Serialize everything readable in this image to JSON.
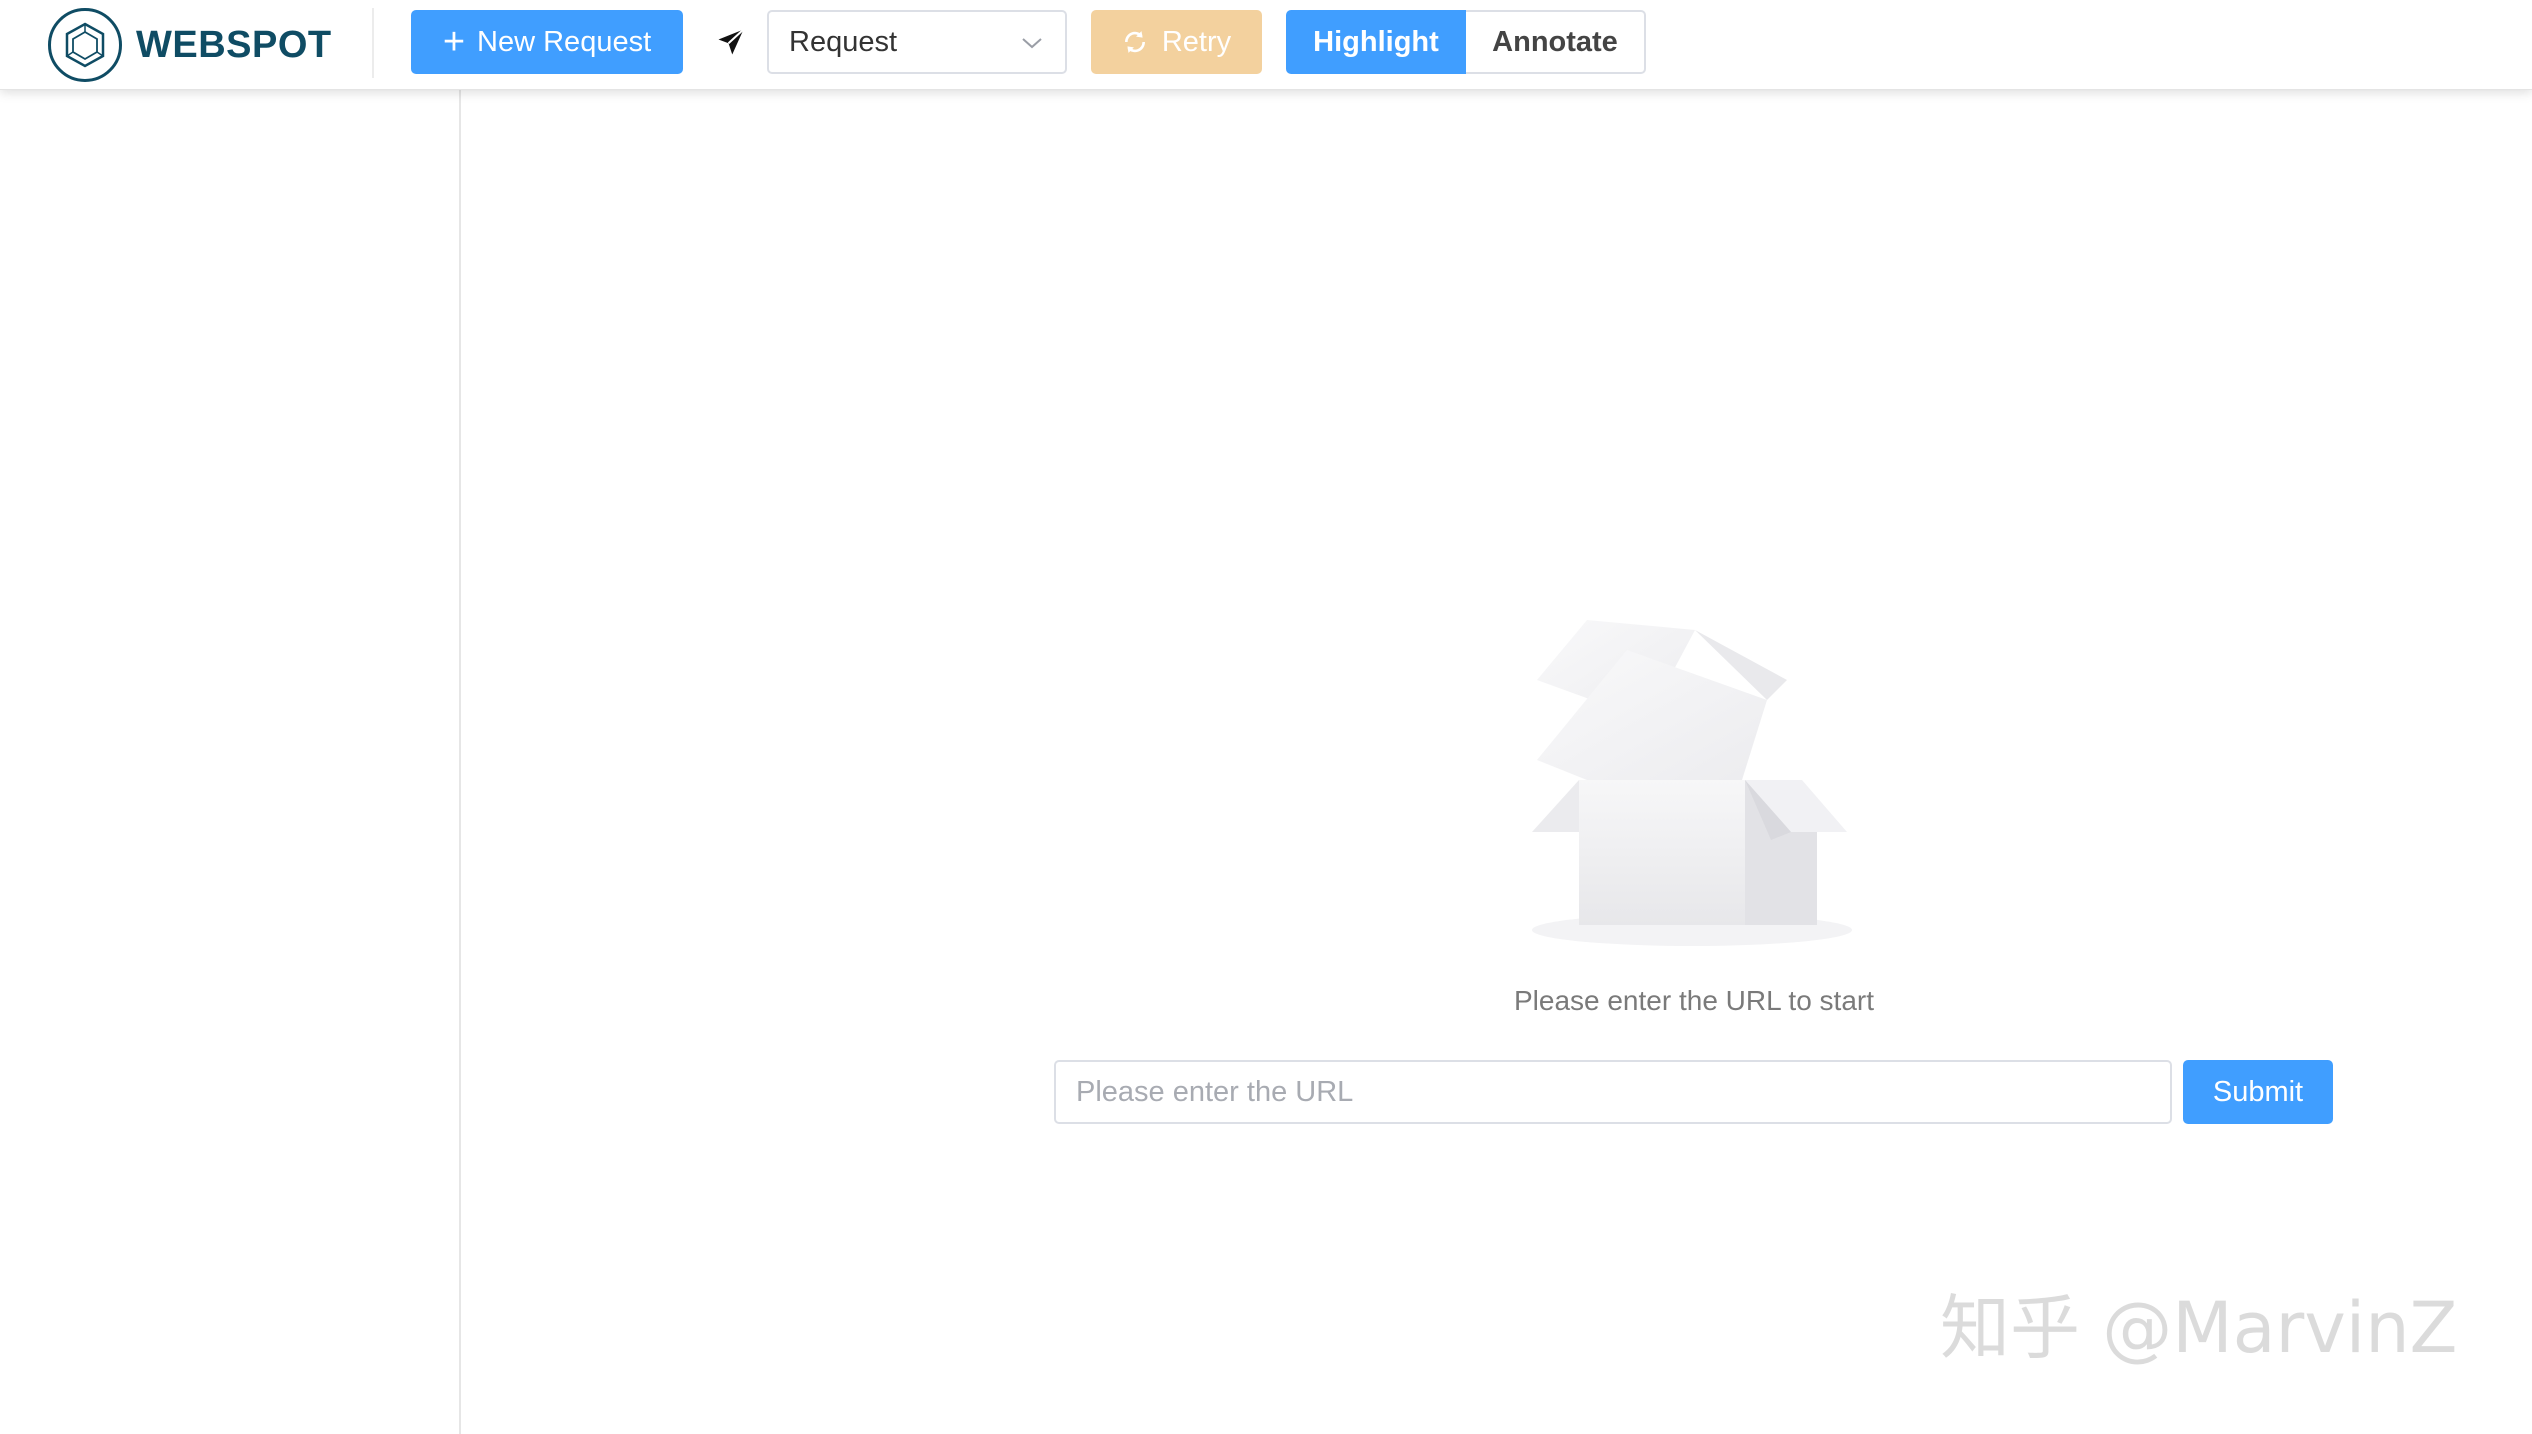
{
  "header": {
    "logo_text": "WEBSPOT",
    "new_request_label": "New Request",
    "mode_select_value": "Request",
    "retry_label": "Retry",
    "view_toggle": {
      "highlight_label": "Highlight",
      "annotate_label": "Annotate",
      "selected": "Highlight"
    }
  },
  "main": {
    "empty_message": "Please enter the URL to start",
    "url_input": {
      "placeholder": "Please enter the URL",
      "value": ""
    },
    "submit_label": "Submit"
  },
  "watermark": "知乎 @MarvinZ",
  "icons": {
    "logo": "hexagon-logo-icon",
    "new_request": "plus-icon",
    "send": "paper-plane-icon",
    "select_arrow": "chevron-down-icon",
    "retry": "refresh-icon",
    "empty_state": "empty-box-icon"
  },
  "colors": {
    "primary": "#409eff",
    "brand": "#0f4c64",
    "retry_disabled": "#f3d19e",
    "border": "#dcdfe6",
    "muted_text": "#7a7a7a"
  }
}
